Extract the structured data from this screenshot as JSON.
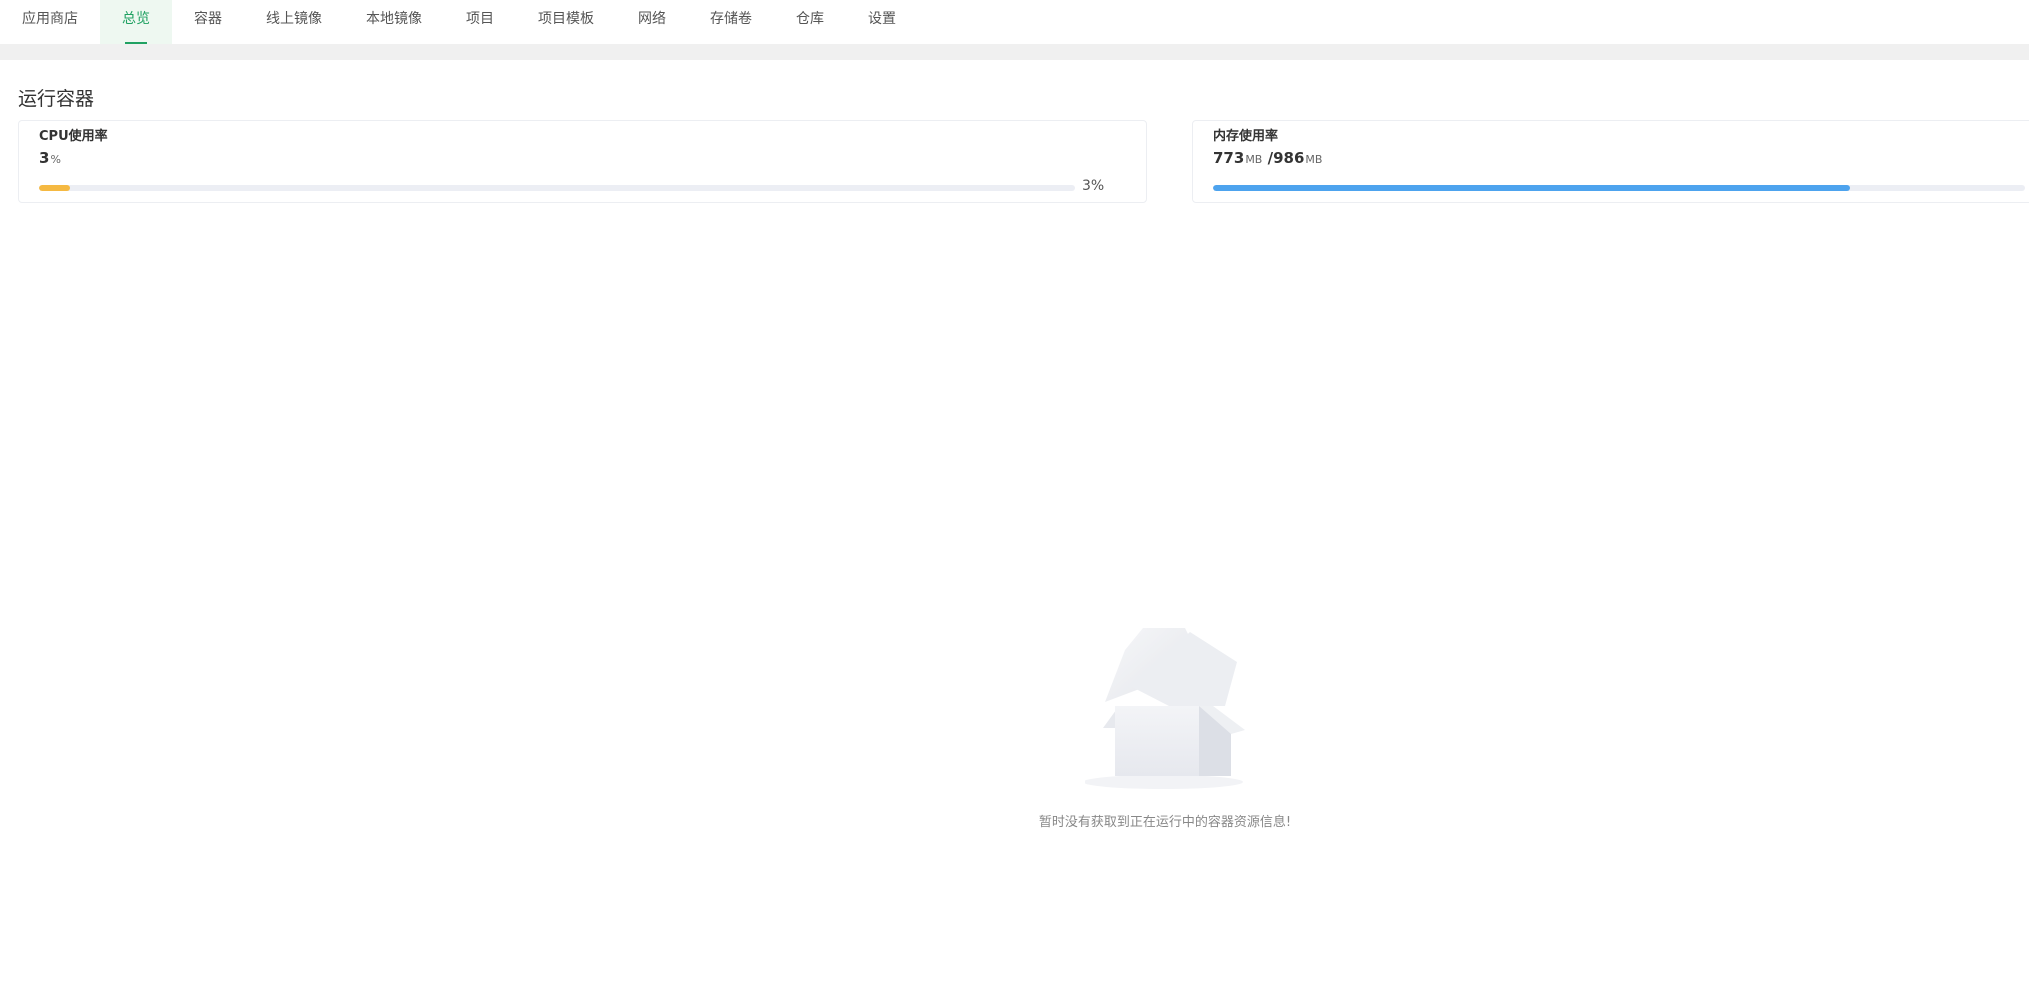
{
  "tabs": [
    {
      "label": "应用商店",
      "active": false
    },
    {
      "label": "总览",
      "active": true
    },
    {
      "label": "容器",
      "active": false
    },
    {
      "label": "线上镜像",
      "active": false
    },
    {
      "label": "本地镜像",
      "active": false
    },
    {
      "label": "项目",
      "active": false
    },
    {
      "label": "项目模板",
      "active": false
    },
    {
      "label": "网络",
      "active": false
    },
    {
      "label": "存储卷",
      "active": false
    },
    {
      "label": "仓库",
      "active": false
    },
    {
      "label": "设置",
      "active": false
    }
  ],
  "section": {
    "title": "运行容器"
  },
  "cpu": {
    "label": "CPU使用率",
    "value": "3",
    "unit": "%",
    "progress_percent": 3,
    "progress_text": "3%",
    "color": "#f5b942"
  },
  "memory": {
    "label": "内存使用率",
    "used": "773",
    "used_unit": "MB",
    "separator": "/",
    "total": "986",
    "total_unit": "MB",
    "progress_percent": 78.4,
    "color": "#4da3ee"
  },
  "empty": {
    "message": "暂时没有获取到正在运行中的容器资源信息!",
    "icon": "empty-box-icon"
  },
  "colors": {
    "accent": "#20a162"
  }
}
